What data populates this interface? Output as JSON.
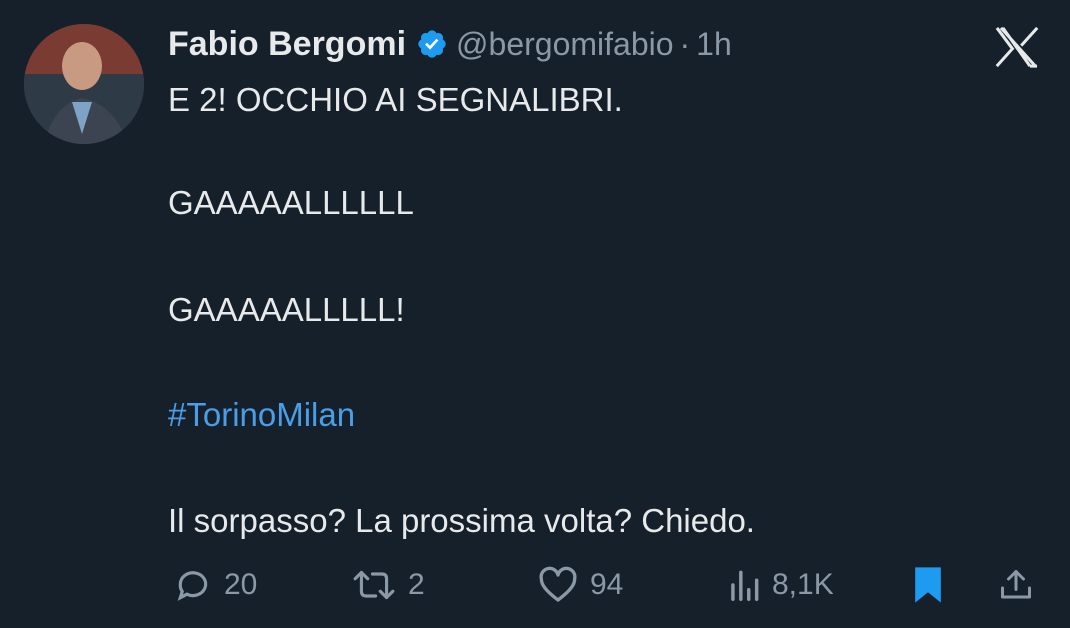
{
  "author": {
    "name": "Fabio Bergomi",
    "handle": "@bergomifabio",
    "separator": "·",
    "time": "1h",
    "verified": true
  },
  "tweet": {
    "line1": "E 2! OCCHIO AI SEGNALIBRI.",
    "line2": "GAAAAALLLLLL",
    "line3": "GAAAAALLLLL!",
    "hashtag": "#TorinoMilan",
    "line5": "Il sorpasso? La prossima volta? Chiedo."
  },
  "actions": {
    "replies": "20",
    "retweets": "2",
    "likes": "94",
    "views": "8,1K"
  },
  "colors": {
    "background": "#15202b",
    "text": "#e7e9ea",
    "muted": "#8b98a5",
    "hashtag": "#4a9ee8",
    "verified": "#1d9bf0",
    "bookmark": "#1d9bf0"
  },
  "icons": [
    "avatar",
    "verified-badge-icon",
    "x-logo-icon",
    "reply-icon",
    "retweet-icon",
    "like-icon",
    "views-icon",
    "bookmark-icon",
    "share-icon"
  ]
}
